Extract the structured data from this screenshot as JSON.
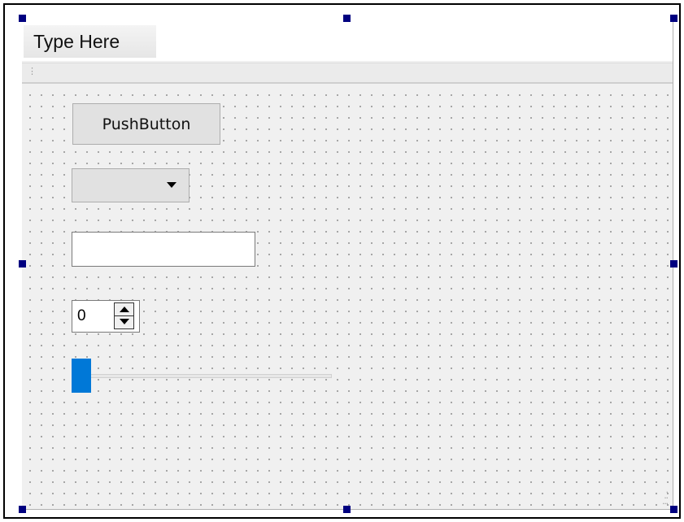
{
  "menubar": {
    "type_here_label": "Type Here"
  },
  "widgets": {
    "push_button_label": "PushButton",
    "combo_box_selected": "",
    "line_edit_value": "",
    "spin_box_value": "0",
    "slider_value_fraction": 0
  },
  "colors": {
    "selection_handles": "#000080",
    "slider_handle": "#0078d7",
    "form_background": "#f0f0f0"
  }
}
